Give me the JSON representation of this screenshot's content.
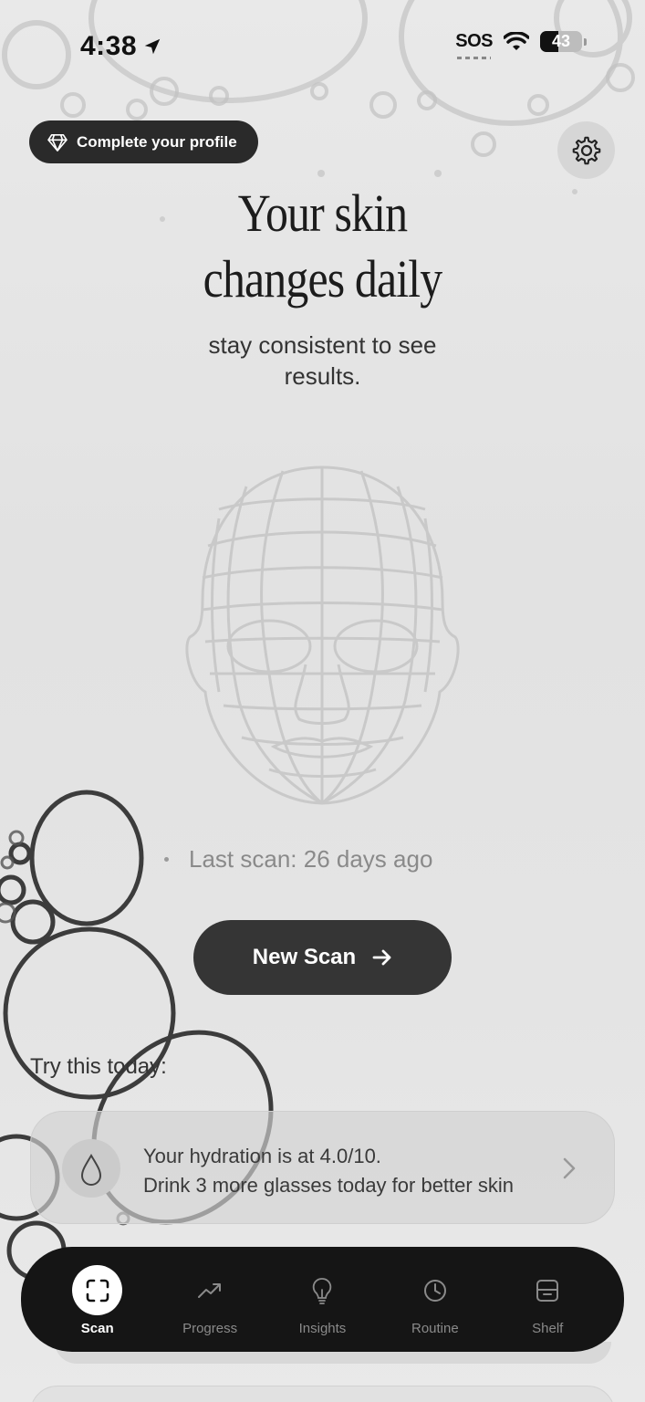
{
  "status_bar": {
    "time": "4:38",
    "carrier": "SOS",
    "battery": "43"
  },
  "profile": {
    "pill_label": "Complete your profile",
    "icon": "diamond-icon"
  },
  "settings": {
    "icon": "gear-icon"
  },
  "hero": {
    "title_line1": "Your skin",
    "title_line2": "changes daily",
    "subtitle_line1": "stay consistent to see",
    "subtitle_line2": "results."
  },
  "scan": {
    "last_scan": "Last scan: 26 days ago",
    "new_scan_label": "New Scan",
    "new_scan_icon": "arrow-right-icon"
  },
  "tips": {
    "heading": "Try this today:",
    "items": [
      {
        "line1": "Your hydration is at 4.0/10.",
        "line2": "Drink 3 more glasses today for better skin",
        "icon": "water-drop-icon"
      }
    ]
  },
  "tabbar": {
    "tabs": [
      {
        "label": "Scan",
        "icon": "scan-icon",
        "active": true
      },
      {
        "label": "Progress",
        "icon": "trend-icon",
        "active": false
      },
      {
        "label": "Insights",
        "icon": "lightbulb-icon",
        "active": false
      },
      {
        "label": "Routine",
        "icon": "clock-icon",
        "active": false
      },
      {
        "label": "Shelf",
        "icon": "shelf-icon",
        "active": false
      }
    ]
  },
  "colors": {
    "accent_dark": "#151515",
    "button": "#353535",
    "background": "#e6e6e6"
  }
}
